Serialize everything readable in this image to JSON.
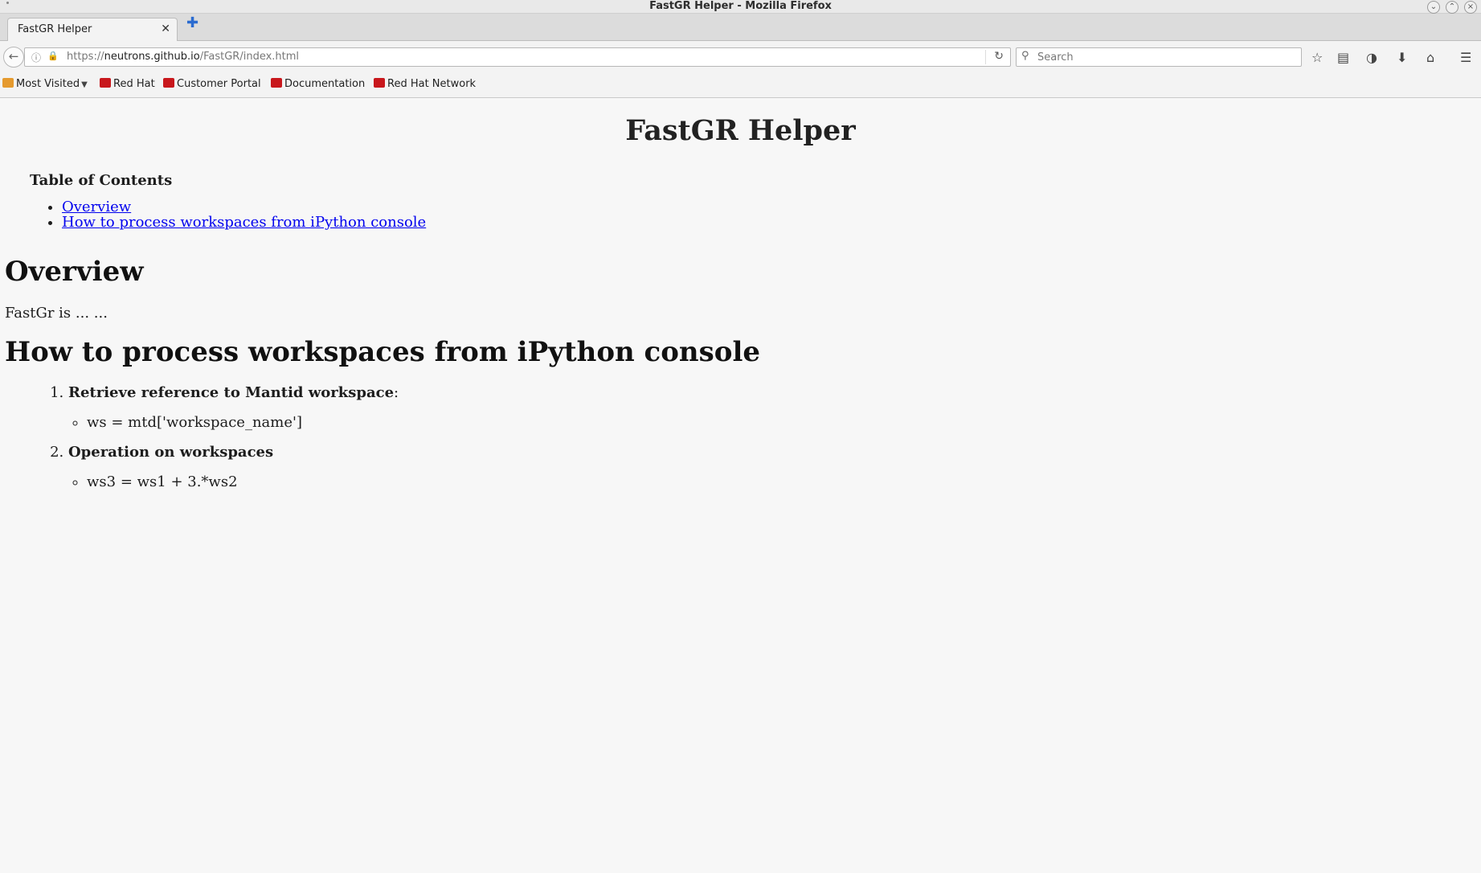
{
  "window": {
    "title": "FastGR Helper - Mozilla Firefox",
    "controls": [
      "minimize",
      "maximize",
      "close"
    ]
  },
  "tabs": [
    {
      "label": "FastGR Helper",
      "active": true
    }
  ],
  "navbar": {
    "url_prefix": "https://",
    "url_host": "neutrons.github.io",
    "url_path": "/FastGR/index.html",
    "search_placeholder": "Search"
  },
  "toolbar_icons": [
    "bookmark-star-icon",
    "reading-list-icon",
    "pocket-icon",
    "downloads-icon",
    "home-icon",
    "menu-icon"
  ],
  "bookmarks": [
    {
      "label": "Most Visited",
      "icon": "folder"
    },
    {
      "label": "Red Hat",
      "icon": "redhat"
    },
    {
      "label": "Customer Portal",
      "icon": "redhat"
    },
    {
      "label": "Documentation",
      "icon": "redhat"
    },
    {
      "label": "Red Hat Network",
      "icon": "redhat"
    }
  ],
  "page": {
    "title": "FastGR Helper",
    "toc": {
      "title": "Table of Contents",
      "items": [
        "Overview",
        "How to process workspaces from iPython console"
      ]
    },
    "overview": {
      "heading": "Overview",
      "text": "FastGr is ... ..."
    },
    "howto": {
      "heading": "How to process workspaces from iPython console",
      "steps": [
        {
          "title": "Retrieve reference to Mantid workspace",
          "suffix": ":",
          "code": "ws = mtd['workspace_name']"
        },
        {
          "title": "Operation on workspaces",
          "suffix": "",
          "code": "ws3 = ws1 + 3.*ws2"
        }
      ]
    }
  },
  "colors": {
    "link": "#0000ee",
    "page_background": "#f7f7f7",
    "chrome_background": "#f3f3f3",
    "redhat": "#c8171c"
  }
}
